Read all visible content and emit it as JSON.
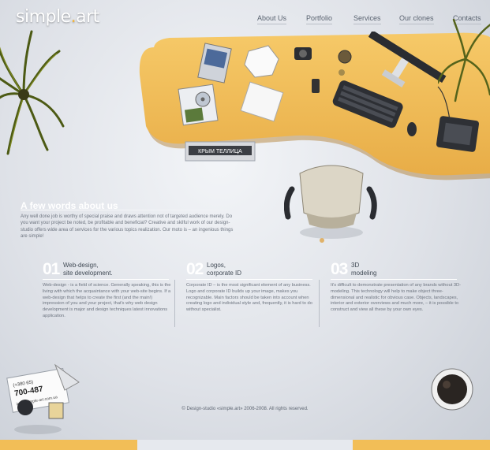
{
  "logo": {
    "text_main": "simple",
    "text_dot": ".",
    "text_end": "art"
  },
  "nav": {
    "items": [
      "About Us",
      "Portfolio",
      "Services",
      "Our clones",
      "Contacts"
    ]
  },
  "desk": {
    "sign_text": "КРЫМ ТЕЛЛИЦА"
  },
  "about": {
    "heading_first": "A",
    "heading_rest": " few words about us",
    "intro": "Any well done job is worthy of special praise and draws attention not of targeted audience merely. Do you want your project be noted, be profitable and beneficial? Creative and skilful work of our design-studio offers wide area of services for the various topics realization. Our moto is – an ingenious things are simple!"
  },
  "services": [
    {
      "num": "01",
      "title_line1": "Web-design,",
      "title_line2": "site development.",
      "body": "Web-design - is a field of science. Generally speaking, this is the living with which the acquaintance with your web-site begins. If a web-design that helps to create the first (and the main!) impression of you and your project, that's why web design development is major and design techniques latest innovations application."
    },
    {
      "num": "02",
      "title_line1": "Logos,",
      "title_line2": "corporate ID",
      "body": "Corporate ID – is the most significant element of any business. Logo and corporate ID builds up your image, makes you recognizable. Main factors should be taken into account when creating logo and individual style and, frequently, it is hard to do without specialist."
    },
    {
      "num": "03",
      "title_line1": "3D",
      "title_line2": "modeling",
      "body": "It's difficult to demonstrate presentation of any brands without 3D-modeling. This technology will help to make object three-dimensional and realistic for obvious case. Objects, landscapes, interior and exterior overviews and much more, – it is possible to construct and view all these by your own eyes."
    }
  ],
  "card": {
    "line1": "(+380 65)",
    "line2": "700-487",
    "line3": "info@simple-art.com.ua"
  },
  "footer": {
    "text": "© Design-studio «simple.art» 2006-2008. All rights reserved."
  },
  "colors": {
    "desk": "#f2be57",
    "background": "#dfe2e8",
    "accent": "#f4b53c"
  }
}
